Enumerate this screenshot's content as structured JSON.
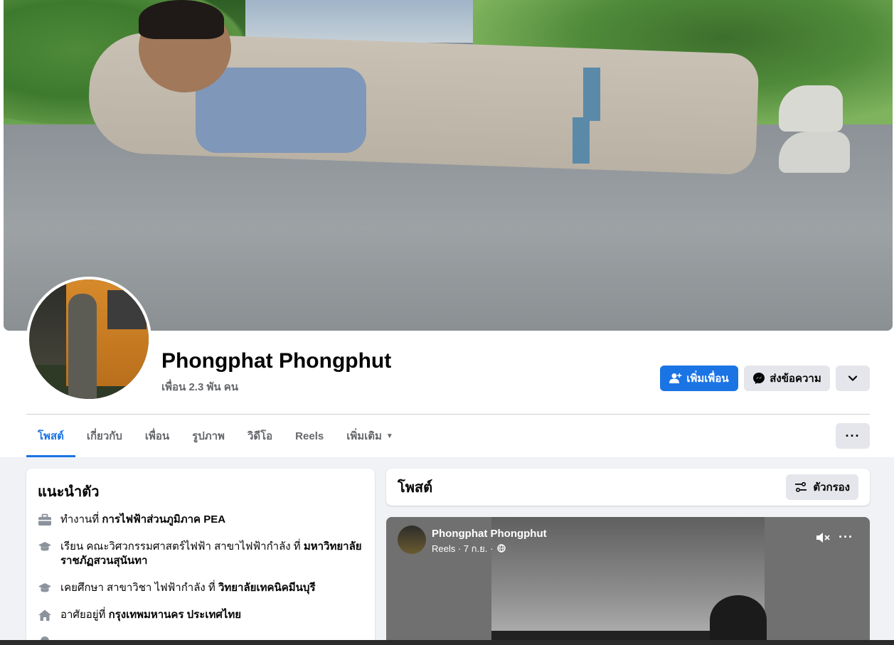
{
  "profile": {
    "name": "Phongphat Phongphut",
    "friends": "เพื่อน 2.3 พัน คน"
  },
  "actions": {
    "add_friend": "เพิ่มเพื่อน",
    "message": "ส่งข้อความ"
  },
  "tabs": [
    {
      "label": "โพสต์",
      "active": true
    },
    {
      "label": "เกี่ยวกับ"
    },
    {
      "label": "เพื่อน"
    },
    {
      "label": "รูปภาพ"
    },
    {
      "label": "วิดีโอ"
    },
    {
      "label": "Reels"
    },
    {
      "label": "เพิ่มเติม"
    }
  ],
  "intro": {
    "title": "แนะนำตัว",
    "items": [
      {
        "icon": "briefcase-icon",
        "prefix": "ทำงานที่ ",
        "bold": "การไฟฟ้าส่วนภูมิภาค PEA",
        "suffix": ""
      },
      {
        "icon": "graduation-cap-icon",
        "prefix": "เรียน คณะวิศวกรรมศาสตร์ไฟฟ้า สาขาไฟฟ้ากำลัง ที่ ",
        "bold": "มหาวิทยาลัยราชภัฏสวนสุนันทา",
        "suffix": ""
      },
      {
        "icon": "graduation-cap-icon",
        "prefix": "เคยศึกษา สาขาวิชา ไฟฟ้ากำลัง ที่ ",
        "bold": "วิทยาลัยเทคนิคมีนบุรี",
        "suffix": ""
      },
      {
        "icon": "home-icon",
        "prefix": "อาศัยอยู่ที่ ",
        "bold": "กรุงเทพมหานคร ประเทศไทย",
        "suffix": ""
      }
    ]
  },
  "posts": {
    "title": "โพสต์",
    "filter": "ตัวกรอง"
  },
  "reel": {
    "author": "Phongphat Phongphut",
    "meta": "Reels · 7 ก.ย. ·"
  },
  "colors": {
    "accent": "#1b74e4",
    "secondary_bg": "#e4e6eb",
    "page_bg": "#f0f2f5"
  }
}
